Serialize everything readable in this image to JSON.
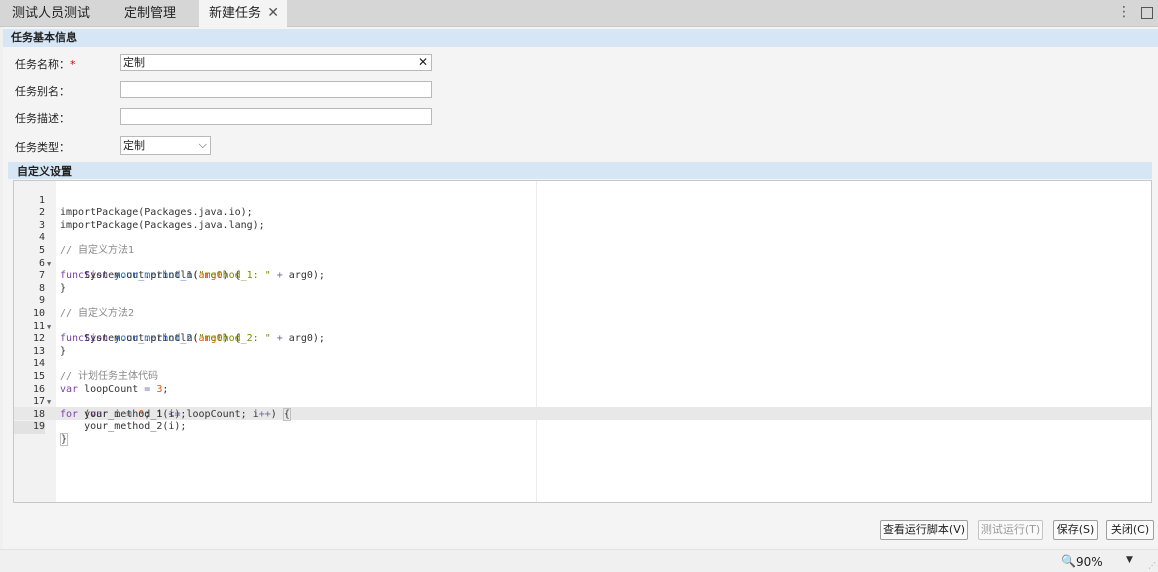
{
  "tabs": [
    {
      "label": "测试人员测试"
    },
    {
      "label": "定制管理"
    },
    {
      "label": "新建任务",
      "close": "✕"
    }
  ],
  "window_controls": {
    "menu": "⋮"
  },
  "basic_section": {
    "title": "任务基本信息"
  },
  "form": {
    "name_label": "任务名称：",
    "required_mark": "*",
    "name_value": "定制",
    "clear_glyph": "✕",
    "alias_label": "任务别名：",
    "alias_value": "",
    "desc_label": "任务描述：",
    "desc_value": "",
    "type_label": "任务类型：",
    "type_value": "定制",
    "type_chevron": "⌵"
  },
  "custom_section": {
    "title": "自定义设置"
  },
  "editor": {
    "active_line": 19,
    "lines": [
      {
        "n": "1",
        "fold": false
      },
      {
        "n": "2",
        "fold": false
      },
      {
        "n": "3",
        "fold": false
      },
      {
        "n": "4",
        "fold": false
      },
      {
        "n": "5",
        "fold": true
      },
      {
        "n": "6",
        "fold": false
      },
      {
        "n": "7",
        "fold": false
      },
      {
        "n": "8",
        "fold": false
      },
      {
        "n": "9",
        "fold": false
      },
      {
        "n": "10",
        "fold": true
      },
      {
        "n": "11",
        "fold": false
      },
      {
        "n": "12",
        "fold": false
      },
      {
        "n": "13",
        "fold": false
      },
      {
        "n": "14",
        "fold": false
      },
      {
        "n": "15",
        "fold": false
      },
      {
        "n": "16",
        "fold": true
      },
      {
        "n": "17",
        "fold": false
      },
      {
        "n": "18",
        "fold": false
      },
      {
        "n": "19",
        "fold": false
      }
    ],
    "code": {
      "l1": "importPackage(Packages.java.io);",
      "l2": "importPackage(Packages.java.lang);",
      "l4": "// 自定义方法1",
      "kw_function": "function",
      "m1_name": "your_method_1",
      "arg": "arg0",
      "l5_tail": ") {",
      "indent": "    ",
      "println": "System.out.println(",
      "m1_str": "\"method_1: \"",
      "plus": " + ",
      "l6_tail": "arg0);",
      "close_brace": "}",
      "l9": "// 自定义方法2",
      "m2_name": "your_method_2",
      "m2_str": "\"method_2: \"",
      "l14": "// 计划任务主体代码",
      "kw_var": "var",
      "loopcount_decl": " loopCount ",
      "eq": "=",
      "three": "3",
      "semi": ";",
      "kw_for": "for",
      "for_open": " (",
      "i_decl": " i ",
      "zero": "0",
      "i_cond": "; i ",
      "le": "<=",
      "loop_rest": " loopCount; i",
      "inc": "++",
      "paren_close": ") ",
      "open_brace": "{",
      "call1": "your_method_1(i);",
      "call2": "your_method_2(i);"
    }
  },
  "buttons": {
    "view_script": "查看运行脚本(V)",
    "test_run": "测试运行(T)",
    "save": "保存(S)",
    "close": "关闭(C)"
  },
  "statusbar": {
    "zoom": "90%",
    "zoom_icon": "🔍",
    "drop": "▼",
    "grip": "⋰"
  },
  "colors": {
    "section_header": "#d6e6f5",
    "keyword": "#7a3ea8",
    "function_name": "#2b6ab8",
    "string": "#7a8a00",
    "number": "#e0570e",
    "comment": "#8a8a8a"
  }
}
